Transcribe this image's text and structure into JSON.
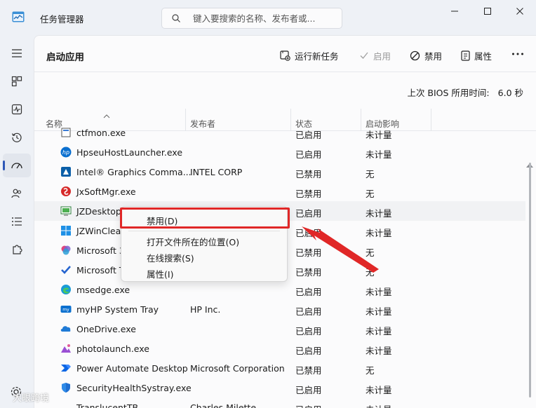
{
  "app": {
    "title": "任务管理器"
  },
  "search": {
    "placeholder": "键入要搜索的名称、发布者或..."
  },
  "page": {
    "title": "启动应用"
  },
  "toolbar": {
    "run_task": "运行新任务",
    "enable": "启用",
    "disable": "禁用",
    "properties": "属性"
  },
  "bios": {
    "label": "上次 BIOS 所用时间:",
    "value": "6.0 秒"
  },
  "columns": {
    "name": "名称",
    "publisher": "发布者",
    "status": "状态",
    "impact": "启动影响"
  },
  "rows": [
    {
      "name": "ctfmon.exe",
      "publisher": "",
      "status": "已启用",
      "impact": "未计量",
      "icon": "ctfmon-icon"
    },
    {
      "name": "HpseuHostLauncher.exe",
      "publisher": "",
      "status": "已启用",
      "impact": "未计量",
      "icon": "hp-icon"
    },
    {
      "name": "Intel® Graphics Comma...",
      "publisher": "INTEL CORP",
      "status": "已禁用",
      "impact": "无",
      "icon": "intel-graphics-icon"
    },
    {
      "name": "JxSoftMgr.exe",
      "publisher": "",
      "status": "已禁用",
      "impact": "无",
      "icon": "jxsoft-icon"
    },
    {
      "name": "JZDesktop",
      "publisher": "",
      "status": "已启用",
      "impact": "未计量",
      "icon": "jzdesktop-icon"
    },
    {
      "name": "JZWinClear",
      "publisher": "",
      "status": "已启用",
      "impact": "未计量",
      "icon": "windows-icon"
    },
    {
      "name": "Microsoft 3",
      "publisher": "",
      "status": "已禁用",
      "impact": "无",
      "icon": "microsoft365-icon"
    },
    {
      "name": "Microsoft T",
      "publisher": "",
      "status": "已禁用",
      "impact": "无",
      "icon": "microsoft-todo-icon"
    },
    {
      "name": "msedge.exe",
      "publisher": "",
      "status": "已启用",
      "impact": "未计量",
      "icon": "edge-icon"
    },
    {
      "name": "myHP System Tray",
      "publisher": "HP Inc.",
      "status": "已启用",
      "impact": "未计量",
      "icon": "myhp-icon"
    },
    {
      "name": "OneDrive.exe",
      "publisher": "",
      "status": "已启用",
      "impact": "未计量",
      "icon": "onedrive-icon"
    },
    {
      "name": "photolaunch.exe",
      "publisher": "",
      "status": "已启用",
      "impact": "未计量",
      "icon": "photos-icon"
    },
    {
      "name": "Power Automate Desktop",
      "publisher": "Microsoft Corporation",
      "status": "已禁用",
      "impact": "无",
      "icon": "power-automate-icon"
    },
    {
      "name": "SecurityHealthSystray.exe",
      "publisher": "",
      "status": "已启用",
      "impact": "未计量",
      "icon": "security-shield-icon"
    },
    {
      "name": "TranslucentTB",
      "publisher": "Charles Milette",
      "status": "已启用",
      "impact": "未计量",
      "icon": "translucenttb-icon"
    }
  ],
  "context_menu": {
    "disable": "禁用(D)",
    "open_location": "打开文件所在的位置(O)",
    "search_online": "在线搜索(S)",
    "properties": "属性(I)"
  },
  "watermark": {
    "text": "大眼跨境"
  },
  "colors": {
    "accent": "#2e57b7",
    "highlight_red": "#e02727"
  }
}
